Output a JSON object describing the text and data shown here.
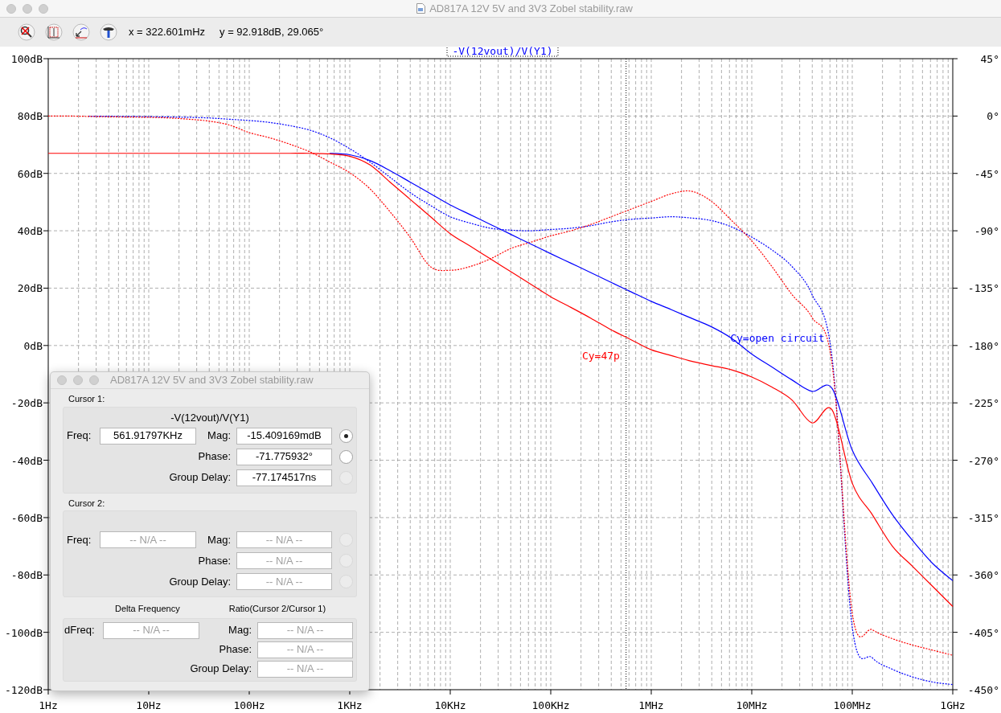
{
  "window": {
    "title": "AD817A 12V 5V and 3V3 Zobel stability.raw"
  },
  "toolbar": {
    "x_readout": "x = 322.601mHz",
    "y_readout": "y = 92.918dB, 29.065°"
  },
  "plot": {
    "chart_data": {
      "type": "line",
      "title": "-V(12vout)/V(Y1)",
      "categories": [
        "1Hz",
        null,
        null,
        null,
        null,
        "10Hz",
        null,
        null,
        null,
        null,
        "100Hz",
        null,
        null,
        null,
        null,
        "1KHz",
        null,
        null,
        null,
        null,
        "10KHz",
        null,
        null,
        null,
        null,
        "100KHz",
        null,
        null,
        null,
        null,
        "1MHz",
        null,
        null,
        null,
        null,
        "10MHz",
        null,
        null,
        null,
        null,
        "100MHz",
        null,
        null,
        null,
        null,
        "1GHz"
      ],
      "ylim": [
        -120,
        100
      ],
      "yticks": [
        {
          "value": 100,
          "label": "100dB"
        },
        {
          "value": 80,
          "label": "80dB"
        },
        {
          "value": 60,
          "label": "60dB"
        },
        {
          "value": 40,
          "label": "40dB"
        },
        {
          "value": 20,
          "label": "20dB"
        },
        {
          "value": 0,
          "label": "0dB"
        },
        {
          "value": -20,
          "label": "-20dB"
        },
        {
          "value": -40,
          "label": "-40dB"
        },
        {
          "value": -60,
          "label": "-60dB"
        },
        {
          "value": -80,
          "label": "-80dB"
        },
        {
          "value": -100,
          "label": "-100dB"
        },
        {
          "value": -120,
          "label": "-120dB"
        }
      ],
      "y2lim": [
        -450,
        45
      ],
      "y2ticks": [
        {
          "value": 45,
          "label": "45°"
        },
        {
          "value": 0,
          "label": "0°"
        },
        {
          "value": -45,
          "label": "-45°"
        },
        {
          "value": -90,
          "label": "-90°"
        },
        {
          "value": -135,
          "label": "-135°"
        },
        {
          "value": -180,
          "label": "-180°"
        },
        {
          "value": -225,
          "label": "-225°"
        },
        {
          "value": -270,
          "label": "-270°"
        },
        {
          "value": -315,
          "label": "-315°"
        },
        {
          "value": -360,
          "label": "-360°"
        },
        {
          "value": -405,
          "label": "-405°"
        },
        {
          "value": -450,
          "label": "-450°"
        }
      ],
      "series": [
        {
          "color": "#ff0000",
          "values": [
            67,
            67,
            67,
            67,
            67,
            67,
            67,
            67,
            67,
            67,
            67,
            67,
            67,
            67,
            66.8,
            66,
            63,
            57,
            51,
            45,
            39,
            34.6,
            30.2,
            25.8,
            21.4,
            17,
            13.3,
            9.5,
            5.5,
            2,
            -1.5,
            -3.5,
            -5.5,
            -7,
            -8.5,
            -11,
            -14.5,
            -19,
            -27,
            -22.5,
            -48,
            -59,
            -70,
            -77,
            -84,
            -91
          ]
        },
        {
          "color": "#0000ff",
          "values": [
            null,
            null,
            null,
            null,
            null,
            null,
            null,
            null,
            null,
            null,
            null,
            null,
            null,
            null,
            67,
            66.5,
            64.5,
            61,
            57,
            53,
            49,
            45.6,
            42.2,
            38.8,
            35.4,
            32,
            28.7,
            25.4,
            22,
            18.7,
            15.4,
            12.5,
            9.5,
            6.5,
            2.5,
            -3,
            -7.5,
            -12,
            -16,
            -15,
            -36.5,
            -48,
            -59,
            -68,
            -76,
            -82
          ]
        },
        {
          "color": "#ff0000",
          "axis": "y2",
          "line_style": "dashed",
          "values": [
            0,
            0,
            -0.3,
            -0.6,
            -0.8,
            -1,
            -1.5,
            -2.5,
            -4,
            -7,
            -13,
            -17,
            -22,
            -28,
            -36,
            -44.5,
            -57,
            -75,
            -95,
            -118,
            -121,
            -118,
            -112,
            -104,
            -99,
            -94,
            -90,
            -85,
            -79,
            -73,
            -67,
            -61,
            -59,
            -67,
            -82,
            -98,
            -118,
            -140,
            -158,
            -195,
            -390,
            -403,
            -410,
            -415,
            -419,
            -423
          ]
        },
        {
          "color": "#0000ff",
          "axis": "y2",
          "line_style": "dashed",
          "values": [
            null,
            null,
            -0.1,
            -0.2,
            -0.3,
            -0.5,
            -0.7,
            -1,
            -1.5,
            -2.5,
            -3.5,
            -5,
            -7.5,
            -11,
            -17,
            -25.6,
            -36,
            -48,
            -60,
            -70,
            -79,
            -84,
            -88,
            -89.5,
            -90,
            -89,
            -88,
            -86,
            -83,
            -81,
            -80,
            -79,
            -80,
            -82,
            -87,
            -95,
            -105,
            -118,
            -140,
            -190,
            -401,
            -425,
            -434,
            -440,
            -444,
            -446
          ]
        }
      ],
      "grid": true,
      "annotations": [
        "Cy=47p",
        "Cy=open circuit"
      ]
    }
  },
  "dialog": {
    "title": "AD817A 12V 5V and 3V3 Zobel stability.raw",
    "cursors": [
      {
        "heading": "Cursor 1:",
        "trace": "-V(12vout)/V(Y1)",
        "freq": {
          "label": "Freq:",
          "value": "561.91797KHz",
          "disabled": false
        },
        "fields": [
          {
            "label": "Mag:",
            "value": "-15.409169mdB",
            "disabled": false,
            "radio": {
              "selected": true,
              "disabled": false
            }
          },
          {
            "label": "Phase:",
            "value": "-71.775932°",
            "disabled": false,
            "radio": {
              "selected": false,
              "disabled": false
            }
          },
          {
            "label": "Group Delay:",
            "value": "-77.174517ns",
            "disabled": false,
            "radio": {
              "selected": false,
              "disabled": true
            }
          }
        ]
      },
      {
        "heading": "Cursor 2:",
        "freq": {
          "label": "Freq:",
          "value": "-- N/A --",
          "disabled": true
        },
        "fields": [
          {
            "label": "Mag:",
            "value": "-- N/A --",
            "disabled": true,
            "radio": {
              "selected": false,
              "disabled": true
            }
          },
          {
            "label": "Phase:",
            "value": "-- N/A --",
            "disabled": true,
            "radio": {
              "selected": false,
              "disabled": true
            }
          },
          {
            "label": "Group Delay:",
            "value": "-- N/A --",
            "disabled": true,
            "radio": {
              "selected": false,
              "disabled": true
            }
          }
        ]
      }
    ],
    "delta": {
      "left_heading": "Delta Frequency",
      "right_heading": "Ratio(Cursor 2/Cursor 1)",
      "freq": {
        "label": "dFreq:",
        "value": "-- N/A --",
        "disabled": true
      },
      "fields": [
        {
          "label": "Mag:",
          "value": "-- N/A --",
          "disabled": true
        },
        {
          "label": "Phase:",
          "value": "-- N/A --",
          "disabled": true
        },
        {
          "label": "Group Delay:",
          "value": "-- N/A --",
          "disabled": true
        }
      ]
    }
  }
}
